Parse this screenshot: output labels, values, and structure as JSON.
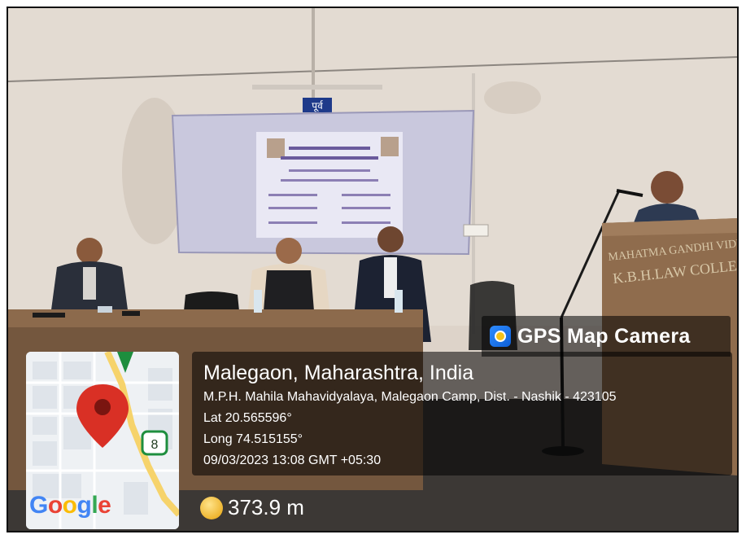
{
  "overlay": {
    "app_badge": "GPS Map Camera",
    "app_icon": "camera-pin-icon",
    "location_title": "Malegaon, Maharashtra, India",
    "address": "M.P.H. Mahila Mahavidyalaya, Malegaon Camp, Dist. - Nashik - 423105",
    "latitude": "Lat 20.565596°",
    "longitude": "Long 74.515155°",
    "datetime": "09/03/2023 13:08 GMT +05:30",
    "altitude": "373.9 m",
    "altitude_icon": "altitude-icon"
  },
  "map": {
    "logo": [
      "G",
      "o",
      "o",
      "g",
      "l",
      "e"
    ],
    "logo_colors": [
      "#4285F4",
      "#EA4335",
      "#FBBC05",
      "#4285F4",
      "#34A853",
      "#EA4335"
    ],
    "route_shield": "8",
    "pin_color": "#d93025"
  },
  "scene": {
    "door_sign": "पूर्व",
    "podium_text_line1": "MAHATMA GANDHI VIDYAM",
    "podium_text_line2": "K.B.H.LAW COLLE"
  }
}
